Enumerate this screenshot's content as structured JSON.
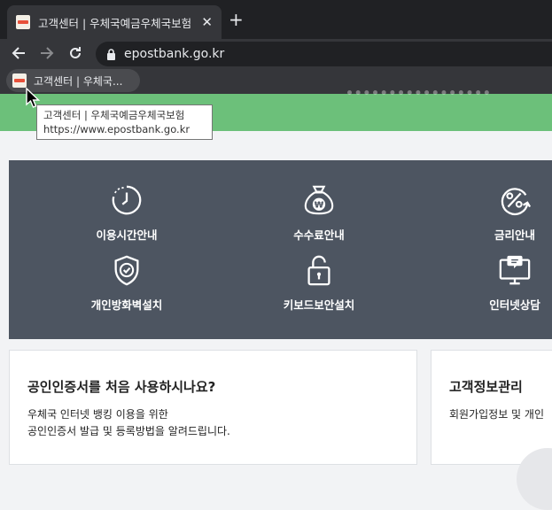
{
  "browser": {
    "tab": {
      "title": "고객센터 | 우체국예금우체국보험"
    },
    "address_bar": {
      "url": "epostbank.go.kr"
    },
    "bookmark": {
      "label": "고객센터 | 우체국..."
    },
    "tooltip": {
      "title": "고객센터 | 우체국예금우체국보험",
      "url": "https://www.epostbank.go.kr"
    }
  },
  "services": [
    {
      "label": "이용시간안내",
      "icon": "clock-icon"
    },
    {
      "label": "수수료안내",
      "icon": "money-bag-won-icon"
    },
    {
      "label": "금리안내",
      "icon": "percent-badge-icon"
    },
    {
      "label": "개인방화벽설치",
      "icon": "shield-check-icon"
    },
    {
      "label": "키보드보안설치",
      "icon": "padlock-icon"
    },
    {
      "label": "인터넷상담",
      "icon": "monitor-chat-icon"
    }
  ],
  "cards": [
    {
      "title": "공인인증서를 처음 사용하시나요?",
      "desc_line1": "우체국 인터넷 뱅킹 이용을 위한",
      "desc_line2": "공인인증서 발급 및 등록방법을 알려드립니다."
    },
    {
      "title": "고객정보관리",
      "desc_line1": "회원가입정보 및 개인"
    }
  ],
  "colors": {
    "banner": "#6cc07a",
    "panel": "#4d5561"
  }
}
